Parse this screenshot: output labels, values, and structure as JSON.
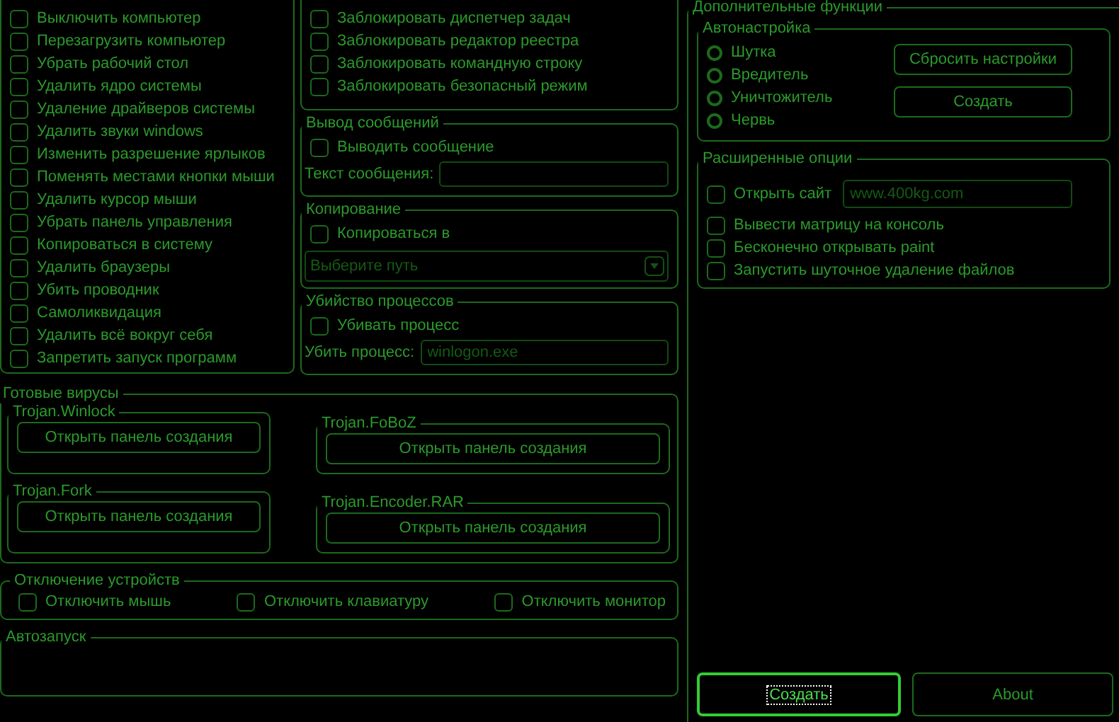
{
  "main_functions": [
    {
      "label": "Выключить компьютер",
      "checked": false
    },
    {
      "label": "Перезагрузить компьютер",
      "checked": false
    },
    {
      "label": "Убрать рабочий стол",
      "checked": false
    },
    {
      "label": "Удалить ядро системы",
      "checked": false
    },
    {
      "label": "Удаление драйверов системы",
      "checked": false
    },
    {
      "label": "Удалить звуки windows",
      "checked": false
    },
    {
      "label": "Изменить разрешение ярлыков",
      "checked": false
    },
    {
      "label": "Поменять местами кнопки мыши",
      "checked": false
    },
    {
      "label": "Удалить курсор мыши",
      "checked": false
    },
    {
      "label": "Убрать панель управления",
      "checked": false
    },
    {
      "label": "Копироваться в систему",
      "checked": false
    },
    {
      "label": "Удалить браузеры",
      "checked": false
    },
    {
      "label": "Убить проводник",
      "checked": false
    },
    {
      "label": "Самоликвидация",
      "checked": false
    },
    {
      "label": "Удалить всё вокруг себя",
      "checked": false
    },
    {
      "label": "Запретить запуск программ",
      "checked": false
    }
  ],
  "blocking": [
    {
      "label": "Заблокировать диспетчер задач",
      "checked": false
    },
    {
      "label": "Заблокировать редактор реестра",
      "checked": false
    },
    {
      "label": "Заблокировать командную строку",
      "checked": false
    },
    {
      "label": "Заблокировать безопасный режим",
      "checked": false
    }
  ],
  "messages": {
    "title": "Вывод сообщений",
    "checkbox": {
      "label": "Выводить сообщение",
      "checked": false
    },
    "field_label": "Текст сообщения:"
  },
  "copying": {
    "title": "Копирование",
    "checkbox": {
      "label": "Копироваться в",
      "checked": false
    },
    "path_placeholder": "Выберите путь"
  },
  "process_kill": {
    "title": "Убийство процессов",
    "checkbox": {
      "label": "Убивать процесс",
      "checked": false
    },
    "field_label": "Убить процесс:",
    "field_placeholder": "winlogon.exe"
  },
  "ready_viruses": {
    "title": "Готовые вирусы",
    "items": [
      {
        "name": "Trojan.Winlock",
        "button": "Открыть панель создания"
      },
      {
        "name": "Trojan.FoBoZ",
        "button": "Открыть панель создания"
      },
      {
        "name": "Trojan.Fork",
        "button": "Открыть панель создания"
      },
      {
        "name": "Trojan.Encoder.RAR",
        "button": "Открыть панель создания"
      }
    ]
  },
  "devices": {
    "title": "Отключение устройств",
    "items": [
      {
        "label": "Отключить мышь",
        "checked": false
      },
      {
        "label": "Отключить клавиатуру",
        "checked": false
      },
      {
        "label": "Отключить монитор",
        "checked": false
      }
    ]
  },
  "autorun": {
    "title": "Автозапуск"
  },
  "extra": {
    "title": "Дополнительные функции",
    "autoconfig": {
      "title": "Автонастройка",
      "modes": [
        {
          "label": "Шутка",
          "selected": false
        },
        {
          "label": "Вредитель",
          "selected": false
        },
        {
          "label": "Уничтожитель",
          "selected": false
        },
        {
          "label": "Червь",
          "selected": false
        }
      ],
      "buttons": [
        "Сбросить настройки",
        "Создать"
      ]
    },
    "advanced": {
      "title": "Расширенные опции",
      "site": {
        "label": "Открыть сайт",
        "checked": false,
        "placeholder": "www.400kg.com"
      },
      "options": [
        {
          "label": "Вывести матрицу на консоль",
          "checked": false
        },
        {
          "label": "Бесконечно открывать paint",
          "checked": false
        },
        {
          "label": "Запустить шуточное удаление файлов",
          "checked": false
        }
      ]
    }
  },
  "buttons": [
    {
      "label": "Создать",
      "focused": true
    },
    {
      "label": "About",
      "focused": false
    }
  ]
}
